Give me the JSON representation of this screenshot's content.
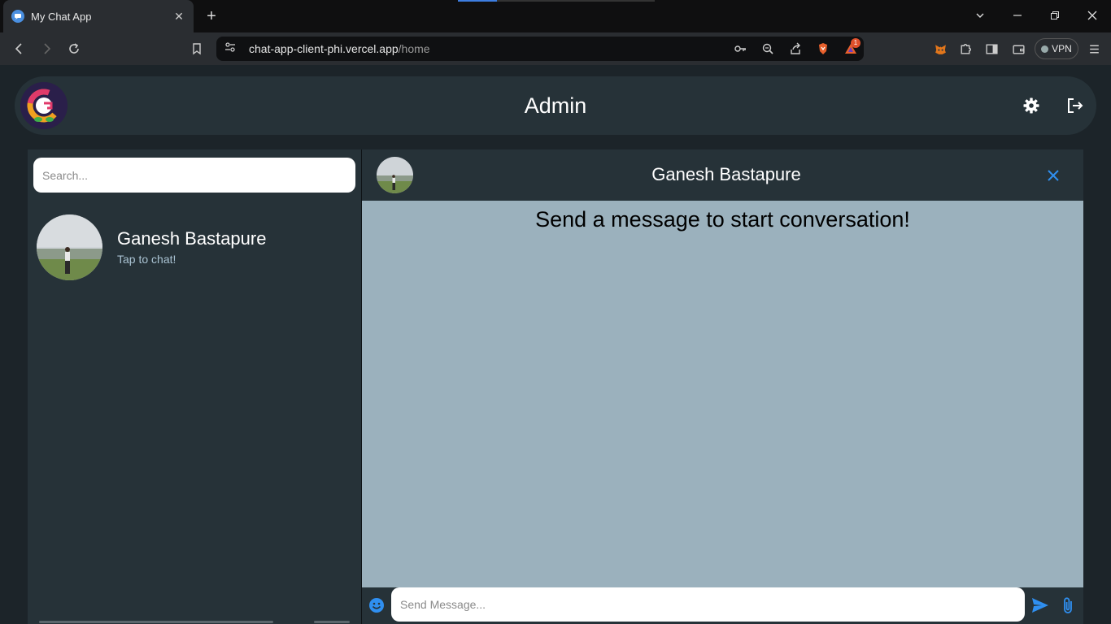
{
  "browser": {
    "tab_title": "My Chat App",
    "url_host": "chat-app-client-phi.vercel.app",
    "url_path": "/home",
    "shields_badge": "1",
    "vpn_label": "VPN"
  },
  "header": {
    "title": "Admin"
  },
  "sidebar": {
    "search_placeholder": "Search...",
    "contacts": [
      {
        "name": "Ganesh Bastapure",
        "subtitle": "Tap to chat!"
      }
    ]
  },
  "chat": {
    "name": "Ganesh Bastapure",
    "empty_message": "Send a message to start conversation!",
    "input_placeholder": "Send Message..."
  },
  "colors": {
    "app_bg": "#1c2429",
    "panel_bg": "#263238",
    "messages_bg": "#9bb1bd",
    "accent": "#2f8ff0"
  }
}
